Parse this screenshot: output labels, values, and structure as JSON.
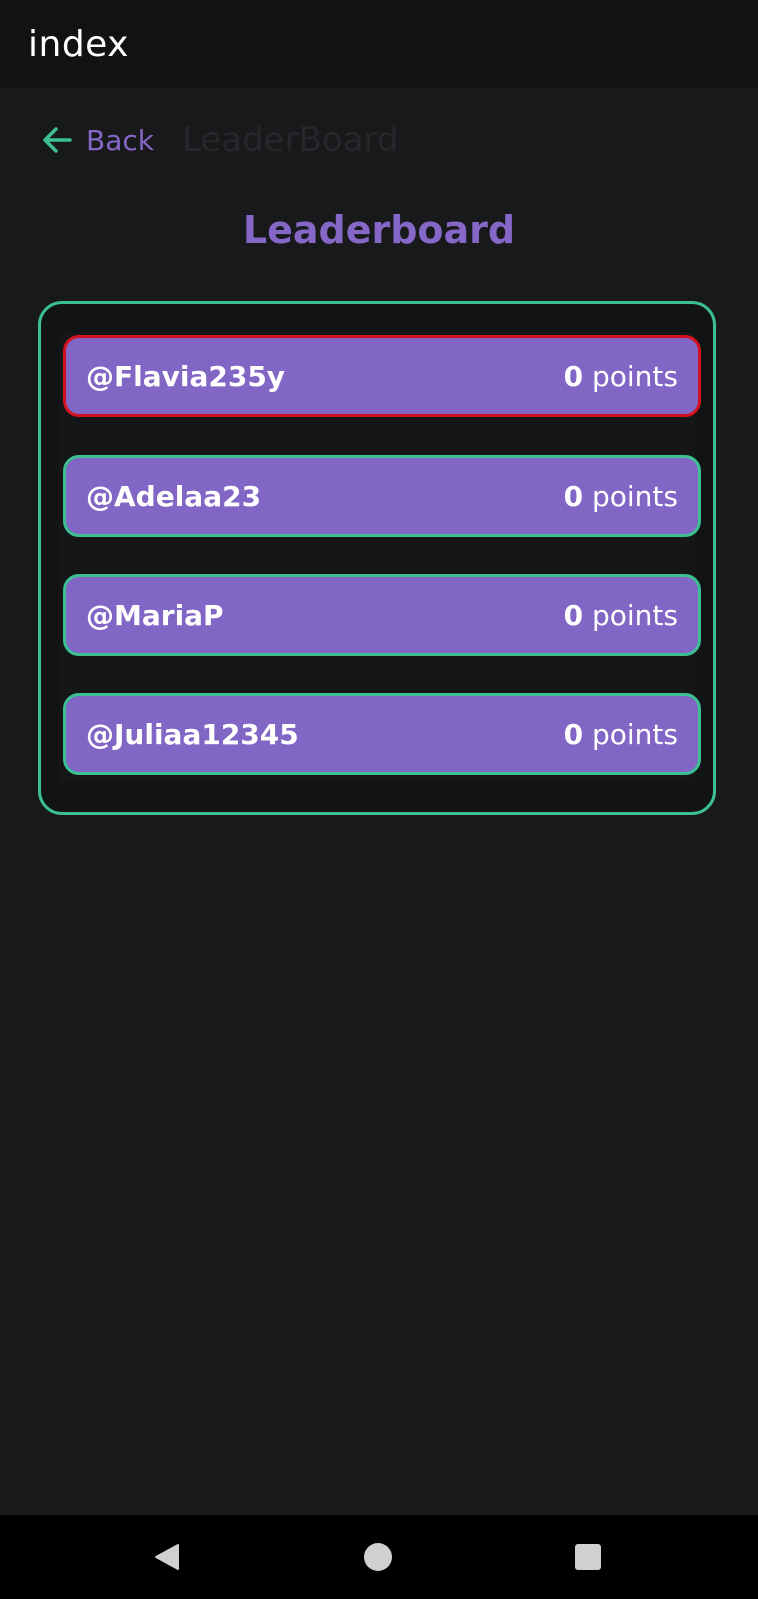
{
  "app_bar": {
    "title": "index"
  },
  "header": {
    "back_label": "Back",
    "faded_title": "LeaderBoard"
  },
  "page_title": "Leaderboard",
  "leaderboard": {
    "points_label": "points",
    "entries": [
      {
        "username": "@Flavia235y",
        "points": "0",
        "highlighted": true
      },
      {
        "username": "@Adelaa23",
        "points": "0",
        "highlighted": false
      },
      {
        "username": "@MariaP",
        "points": "0",
        "highlighted": false
      },
      {
        "username": "@Juliaa12345",
        "points": "0",
        "highlighted": false
      }
    ]
  },
  "colors": {
    "background": "#18191b",
    "accent_purple": "#8667c8",
    "row_purple": "#8266c6",
    "accent_green": "#3bbf93",
    "highlight_red": "#d3121f"
  },
  "icons": {
    "back": "arrow-left-icon",
    "nav_back": "triangle-back-icon",
    "nav_home": "circle-home-icon",
    "nav_recents": "square-recents-icon"
  }
}
